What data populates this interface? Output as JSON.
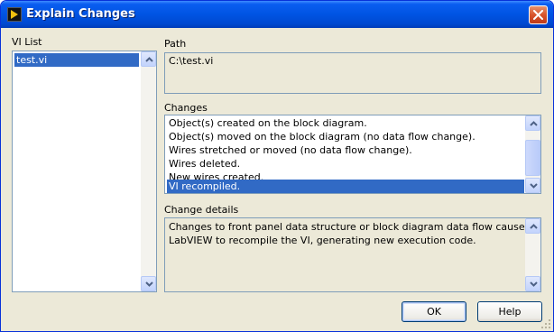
{
  "window": {
    "title": "Explain Changes",
    "close_icon": "close-icon"
  },
  "vi_list": {
    "label": "VI List",
    "items": [
      "test.vi"
    ],
    "selected_index": 0
  },
  "path": {
    "label": "Path",
    "value": "C:\\test.vi"
  },
  "changes": {
    "label": "Changes",
    "items": [
      "Object(s) created on the block diagram.",
      "Object(s) moved on the block diagram (no data flow change).",
      "Wires stretched or moved (no data flow change).",
      "Wires deleted.",
      "New wires created.",
      "VI recompiled."
    ],
    "selected_index": 5
  },
  "change_details": {
    "label": "Change details",
    "lines": [
      "Changes to front panel data structure or block diagram data flow causes",
      "LabVIEW to recompile the VI, generating new execution code."
    ]
  },
  "buttons": {
    "ok": "OK",
    "help": "Help"
  },
  "colors": {
    "title_bar": "#0054e3",
    "selection": "#316ac5",
    "dialog_bg": "#ece9d8",
    "border": "#7f9db9"
  }
}
